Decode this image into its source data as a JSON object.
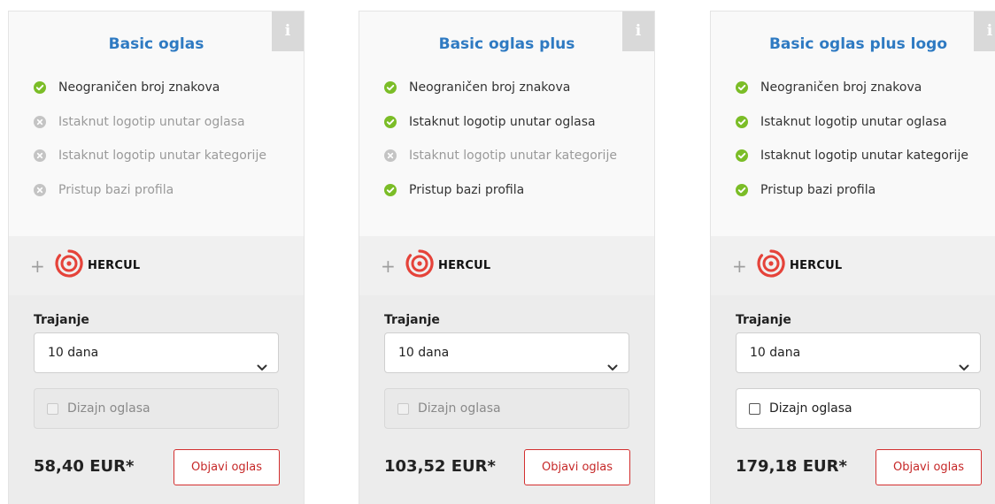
{
  "colors": {
    "accent": "#2e7ac2",
    "check_on": "#7bbd27",
    "check_off": "#c4c4c4",
    "publish": "#d32f2f",
    "hercul": "#e5433a"
  },
  "cards": [
    {
      "title": "Basic oglas",
      "info_label": "i",
      "features": [
        {
          "label": "Neograničen broj znakova",
          "included": true
        },
        {
          "label": "Istaknut logotip unutar oglasa",
          "included": false
        },
        {
          "label": "Istaknut logotip unutar kategorije",
          "included": false
        },
        {
          "label": "Pristup bazi profila",
          "included": false
        }
      ],
      "partner": {
        "plus": "+",
        "logo_text": "HERCUL",
        "logo_icon": "hercul-target-icon"
      },
      "duration_label": "Trajanje",
      "duration_value": "10 dana",
      "design_label": "Dizajn oglasa",
      "design_enabled": false,
      "price": "58,40 EUR*",
      "publish_label": "Objavi oglas"
    },
    {
      "title": "Basic oglas plus",
      "info_label": "i",
      "features": [
        {
          "label": "Neograničen broj znakova",
          "included": true
        },
        {
          "label": "Istaknut logotip unutar oglasa",
          "included": true
        },
        {
          "label": "Istaknut logotip unutar kategorije",
          "included": false
        },
        {
          "label": "Pristup bazi profila",
          "included": true
        }
      ],
      "partner": {
        "plus": "+",
        "logo_text": "HERCUL",
        "logo_icon": "hercul-target-icon"
      },
      "duration_label": "Trajanje",
      "duration_value": "10 dana",
      "design_label": "Dizajn oglasa",
      "design_enabled": false,
      "price": "103,52 EUR*",
      "publish_label": "Objavi oglas"
    },
    {
      "title": "Basic oglas plus logo",
      "info_label": "i",
      "features": [
        {
          "label": "Neograničen broj znakova",
          "included": true
        },
        {
          "label": "Istaknut logotip unutar oglasa",
          "included": true
        },
        {
          "label": "Istaknut logotip unutar kategorije",
          "included": true
        },
        {
          "label": "Pristup bazi profila",
          "included": true
        }
      ],
      "partner": {
        "plus": "+",
        "logo_text": "HERCUL",
        "logo_icon": "hercul-target-icon"
      },
      "duration_label": "Trajanje",
      "duration_value": "10 dana",
      "design_label": "Dizajn oglasa",
      "design_enabled": true,
      "price": "179,18 EUR*",
      "publish_label": "Objavi oglas"
    }
  ]
}
